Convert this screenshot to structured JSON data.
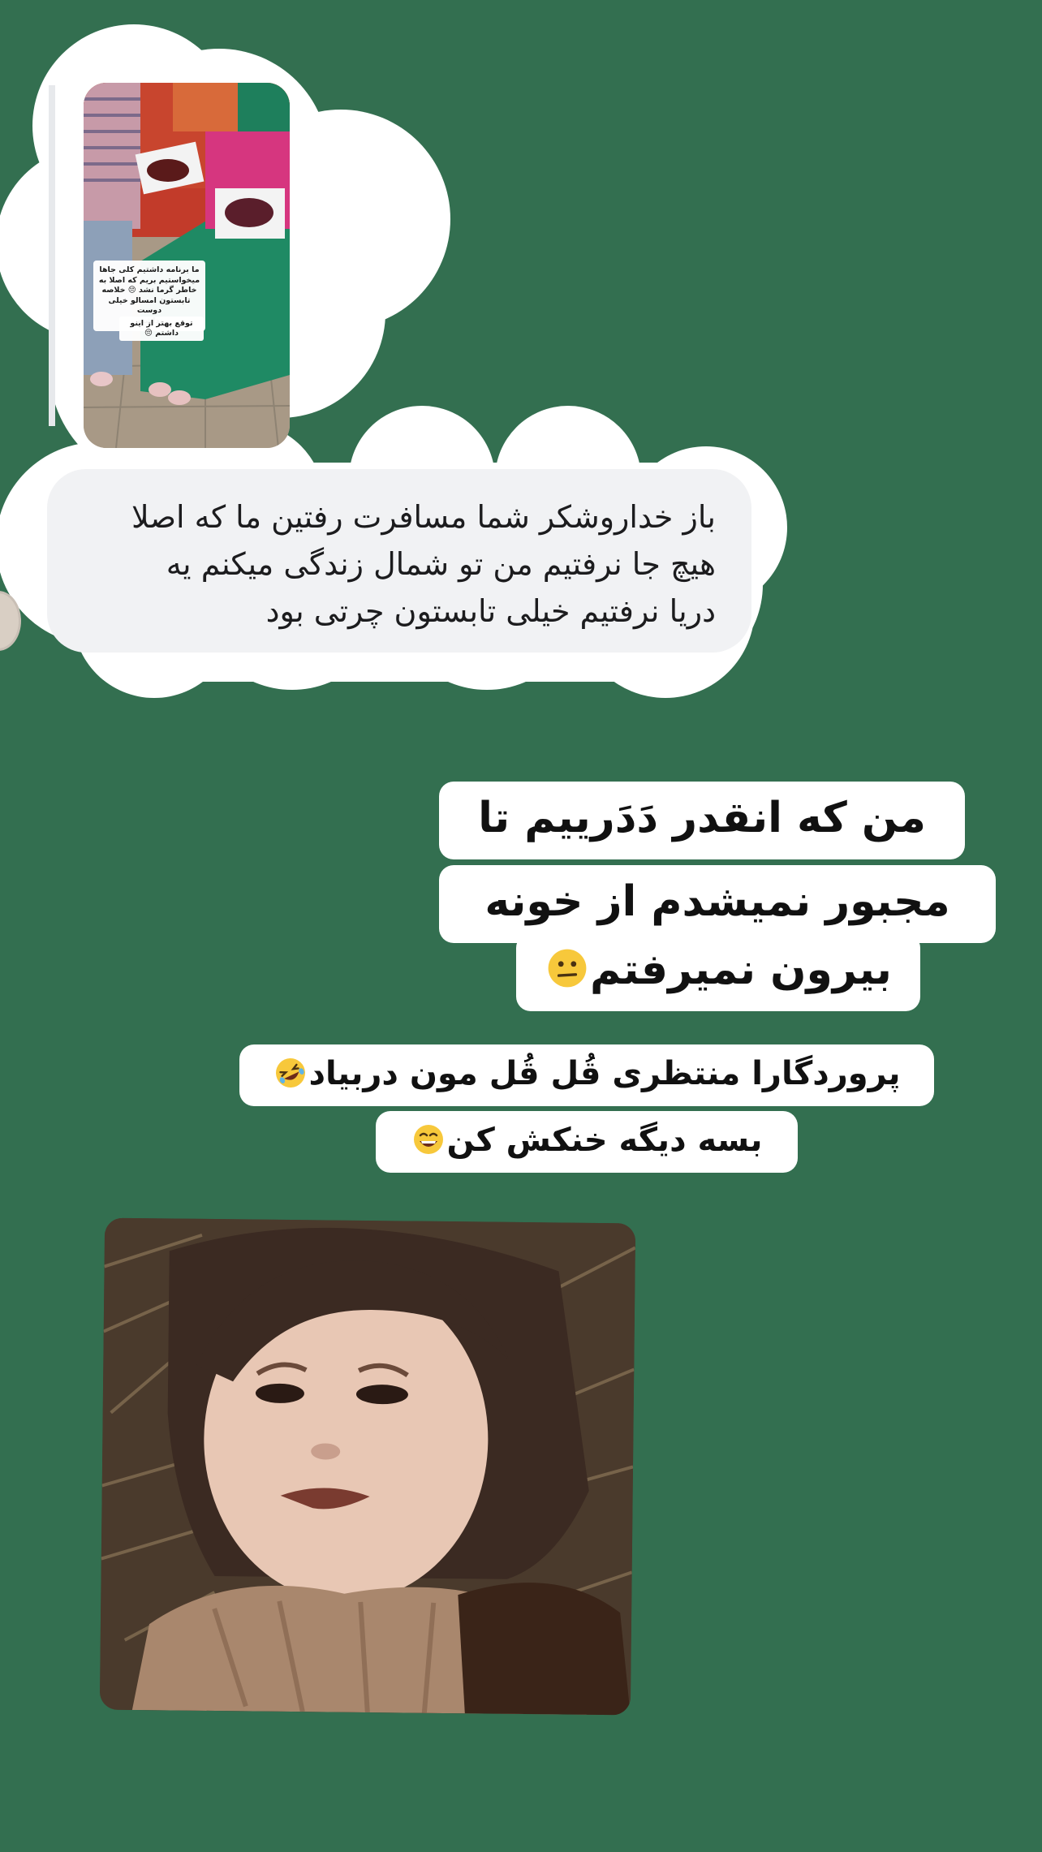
{
  "colors": {
    "background": "#336f50",
    "bubble": "#f1f2f4",
    "sticker": "#ffffff"
  },
  "story_reply": {
    "story_caption": "ما برنامه داشتیم کلی جاها\nمیخواستیم بریم که اصلا به\nخاطر گرما نشد 😔 خلاصه\nتابستون امسالو خیلی دوست\nنداشتم",
    "story_caption_2": "توقع بهتر از اینو داشتم 😔",
    "reply_text": "باز خداروشکر شما مسافرت رفتین ما که اصلا\nهیچ جا نرفتیم من تو شمال زندگی میکنم یه\nدریا نرفتیم خیلی تابستون چرتی بود"
  },
  "overlay_text": {
    "line1": "من که انقدر دَدَرییم تا",
    "line2": "مجبور نمیشدم از خونه",
    "line3": "بیرون نمیرفتم",
    "line3_emoji": "confused-face-emoji",
    "line4": "پروردگارا منتظری قُل قُل مون دربیاد",
    "line4_emoji": "rolling-laughing-emoji",
    "line5": "بسه دیگه خنکش کن",
    "line5_emoji": "grinning-face-emoji"
  },
  "images": {
    "story_thumbnail": "story-photo-food-plates",
    "meme_photo": "sad-toddler-in-scarf-photo"
  }
}
